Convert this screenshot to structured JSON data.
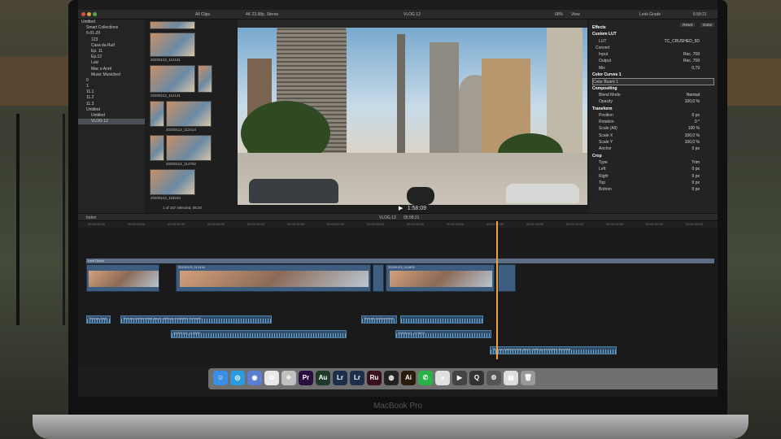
{
  "window": {
    "title": "VLOG 12",
    "format": "4K 23.98p, Stereo"
  },
  "toolbar": {
    "clips_filter": "All Clips",
    "zoom": "68%",
    "view": "View",
    "inspector_title": "Look Grade",
    "duration": "6:58:21"
  },
  "library": {
    "items": [
      {
        "label": "Untitled",
        "level": 0,
        "selected": false
      },
      {
        "label": "Smart Collections",
        "level": 1,
        "selected": false
      },
      {
        "label": "6-01-20",
        "level": 1,
        "selected": false
      },
      {
        "label": "123",
        "level": 2,
        "selected": false
      },
      {
        "label": "Casa da Ruif",
        "level": 2,
        "selected": false
      },
      {
        "label": "Ep. 11",
        "level": 2,
        "selected": false
      },
      {
        "label": "Ep.12",
        "level": 2,
        "selected": false
      },
      {
        "label": "Luiz",
        "level": 2,
        "selected": false
      },
      {
        "label": "Mac e Anrê",
        "level": 2,
        "selected": false
      },
      {
        "label": "Music Musicbed",
        "level": 2,
        "selected": false
      },
      {
        "label": "0",
        "level": 1,
        "selected": false
      },
      {
        "label": "1",
        "level": 1,
        "selected": false
      },
      {
        "label": "11.1",
        "level": 1,
        "selected": false
      },
      {
        "label": "11.2",
        "level": 1,
        "selected": false
      },
      {
        "label": "11.3",
        "level": 1,
        "selected": false
      },
      {
        "label": "Untitled",
        "level": 1,
        "selected": false
      },
      {
        "label": "Untitled",
        "level": 2,
        "selected": false
      },
      {
        "label": "VLOG 12",
        "level": 2,
        "selected": true
      }
    ]
  },
  "browser": {
    "clips": [
      "20200113_112101",
      "20200113_112141",
      "20200113_112414",
      "20200113_114702",
      "20200113_115043"
    ],
    "status": "1 of 167 selected, 08:20"
  },
  "viewer": {
    "title": "VLOG 12",
    "zoom": "68%",
    "view": "View",
    "timecode": "1:58:09"
  },
  "inspector": {
    "reset": "Reset",
    "done": "Done",
    "rows": [
      {
        "label": "Effects",
        "value": "",
        "type": "sec"
      },
      {
        "label": "Custom LUT",
        "value": "",
        "type": "sec"
      },
      {
        "label": "LUT",
        "value": "TC_CRUSHED_5D",
        "type": "row"
      },
      {
        "label": "Convert",
        "value": "",
        "type": "sub"
      },
      {
        "label": "Input",
        "value": "Rec. 709",
        "type": "row"
      },
      {
        "label": "Output",
        "value": "Rec. 709",
        "type": "row"
      },
      {
        "label": "Mix",
        "value": "0,79",
        "type": "row"
      },
      {
        "label": "Color Curves 1",
        "value": "",
        "type": "sec"
      },
      {
        "label": "Color Board 1",
        "value": "",
        "type": "hl"
      },
      {
        "label": "Compositing",
        "value": "",
        "type": "sec"
      },
      {
        "label": "Blend Mode",
        "value": "Normal",
        "type": "row"
      },
      {
        "label": "Opacity",
        "value": "100,0 %",
        "type": "row"
      },
      {
        "label": "Transform",
        "value": "",
        "type": "sec"
      },
      {
        "label": "Position",
        "value": "0 px",
        "type": "row"
      },
      {
        "label": "Rotation",
        "value": "0 °",
        "type": "row"
      },
      {
        "label": "Scale (All)",
        "value": "100 %",
        "type": "row"
      },
      {
        "label": "Scale X",
        "value": "100,0 %",
        "type": "row"
      },
      {
        "label": "Scale Y",
        "value": "100,0 %",
        "type": "row"
      },
      {
        "label": "Anchor",
        "value": "0 px",
        "type": "row"
      },
      {
        "label": "Crop",
        "value": "",
        "type": "sec"
      },
      {
        "label": "Type",
        "value": "Trim",
        "type": "row"
      },
      {
        "label": "Left",
        "value": "0 px",
        "type": "row"
      },
      {
        "label": "Right",
        "value": "0 px",
        "type": "row"
      },
      {
        "label": "Top",
        "value": "0 px",
        "type": "row"
      },
      {
        "label": "Bottom",
        "value": "0 px",
        "type": "row"
      }
    ],
    "save_preset": "Save Effects Preset"
  },
  "timeline": {
    "index": "Index",
    "project": "VLOG 12",
    "timecode": "05:58:21",
    "ruler": [
      "00:00:20:00",
      "00:00:25:00",
      "00:00:30:00",
      "00:00:35:00",
      "00:00:40:00",
      "00:00:45:00",
      "00:00:50:00",
      "00:00:55:00",
      "00:01:00:00",
      "00:01:05:00",
      "00:01:10:00",
      "00:01:15:00",
      "00:01:20:00",
      "00:01:25:00",
      "00:01:30:00",
      "00:01:35:00"
    ],
    "primary_label": "Lerê Ólado",
    "video_clips": [
      "20200113_112114",
      "20200113_112414",
      "20200113_113802",
      "20200113_115043"
    ],
    "audio_clips": [
      "Texture-Instr",
      "Texture-instrumental-jason-dartkup-musicbed-licensed",
      "Texture-Instrumental",
      "20200113_112000",
      "20200113_113603",
      "Texture-instrumental-jason-dartkup-musicbed-licensed"
    ]
  },
  "dock": {
    "apps": [
      "Finder",
      "Safari",
      "Siri",
      "Photos",
      "Launchpad",
      "Premiere",
      "Audition",
      "Lightroom",
      "Lightroom Classic",
      "Rush",
      "DaVinci",
      "Illustrator",
      "WhatsApp",
      "Chrome",
      "Final Cut",
      "QuickTime",
      "Compressor",
      "Preview",
      "Trash"
    ]
  },
  "hardware": {
    "brand": "MacBook Pro"
  }
}
